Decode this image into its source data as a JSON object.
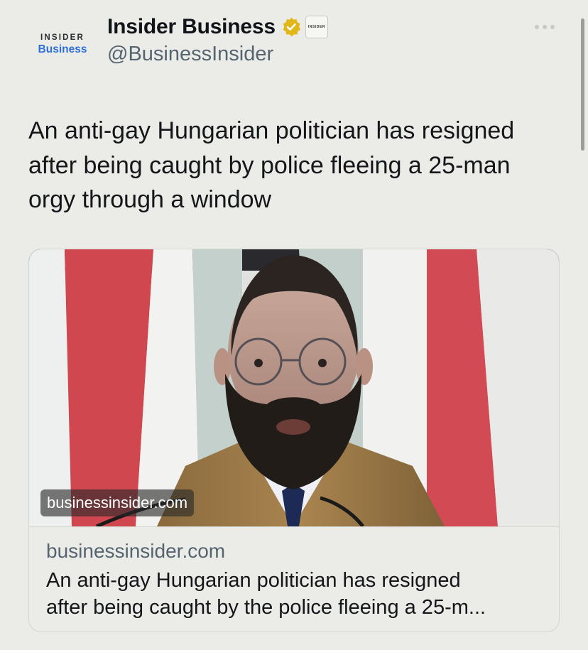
{
  "account": {
    "avatar_line1": "INSIDER",
    "avatar_line2": "Business",
    "display_name": "Insider Business",
    "handle": "@BusinessInsider",
    "affiliate_badge": "INSIDER"
  },
  "tweet": {
    "text_lines": [
      "An anti-gay Hungarian politician has resigned",
      "after being caught by police fleeing a 25-man",
      "orgy through a window"
    ]
  },
  "card": {
    "image_label": "businessinsider.com",
    "domain": "businessinsider.com",
    "title_lines": [
      "An anti-gay Hungarian politician has resigned",
      "after being caught by the police fleeing a 25-m..."
    ]
  },
  "icons": {
    "verified": "verified-badge-icon",
    "more": "more-options-icon"
  },
  "colors": {
    "background": "#ebece8",
    "verified_gold": "#e2b719",
    "brand_blue": "#2f6fd8",
    "secondary_text": "#566470"
  }
}
